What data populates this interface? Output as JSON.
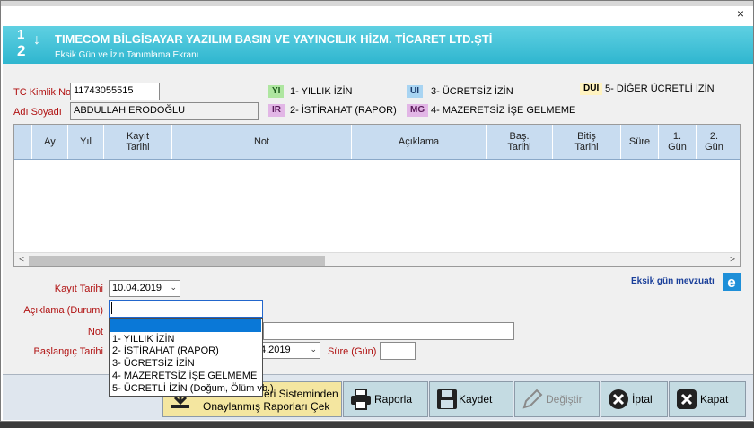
{
  "window": {
    "close_label": "×"
  },
  "header": {
    "logo_top": "1",
    "logo_bottom": "2",
    "logo_arrow": "↓",
    "title": "TIMECOM BİLGİSAYAR YAZILIM BASIN VE YAYINCILIK HİZM. TİCARET LTD.ŞTİ",
    "subtitle": "Eksik Gün ve İzin Tanımlama Ekranı"
  },
  "person": {
    "tc_label": "TC Kimlik No",
    "tc_value": "11743055515",
    "name_label": "Adı Soyadı",
    "name_value": "ABDULLAH ERODOĞLU"
  },
  "legend": [
    {
      "code": "YI",
      "text": "1- YILLIK İZİN",
      "bg": "#aee6a0"
    },
    {
      "code": "IR",
      "text": "2- İSTİRAHAT (RAPOR)",
      "bg": "#e2b6e6"
    },
    {
      "code": "UI",
      "text": "3- ÜCRETSİZ İZİN",
      "bg": "#a8d4f2"
    },
    {
      "code": "MG",
      "text": "4- MAZERETSİZ İŞE GELMEME",
      "bg": "#e2b6e6"
    },
    {
      "code": "DUI",
      "text": "5- DİĞER ÜCRETLİ İZİN",
      "bg": "#fff3c0"
    }
  ],
  "grid": {
    "columns": [
      "Ay",
      "Yıl",
      "Kayıt Tarihi",
      "Not",
      "Açıklama",
      "Baş. Tarihi",
      "Bitiş Tarihi",
      "Süre",
      "1. Gün",
      "2. Gün"
    ],
    "rows": []
  },
  "form": {
    "kayit_label": "Kayıt Tarihi",
    "kayit_value": "10.04.2019",
    "aciklama_label": "Açıklama (Durum)",
    "aciklama_value": "",
    "not_label": "Not",
    "not_value": "",
    "baslangic_label": "Başlangıç Tarihi",
    "baslangic_value": "4.2019",
    "sure_label": "Süre (Gün)",
    "sure_value": ""
  },
  "dropdown": {
    "options": [
      "1- YILLIK İZİN",
      "2- İSTİRAHAT (RAPOR)",
      "3- ÜCRETSİZ İZİN",
      "4- MAZERETSİZ İŞE GELMEME",
      "5- ÜCRETLİ İZİN (Doğum, Ölüm vb.)"
    ]
  },
  "link": {
    "mevzuat": "Eksik gün mevzuatı"
  },
  "buttons": {
    "reports_line1": "eri Sisteminden",
    "reports_line2": "Onaylanmış Raporları Çek",
    "raporla": "Raporla",
    "kaydet": "Kaydet",
    "degistir": "Değiştir",
    "iptal": "İptal",
    "kapat": "Kapat"
  },
  "colors": {
    "header": "#2fb6cf",
    "label": "#b01010",
    "grid_header": "#c8dcf0",
    "highlight": "#0a78d7",
    "reports_button": "#f4e6a0"
  }
}
